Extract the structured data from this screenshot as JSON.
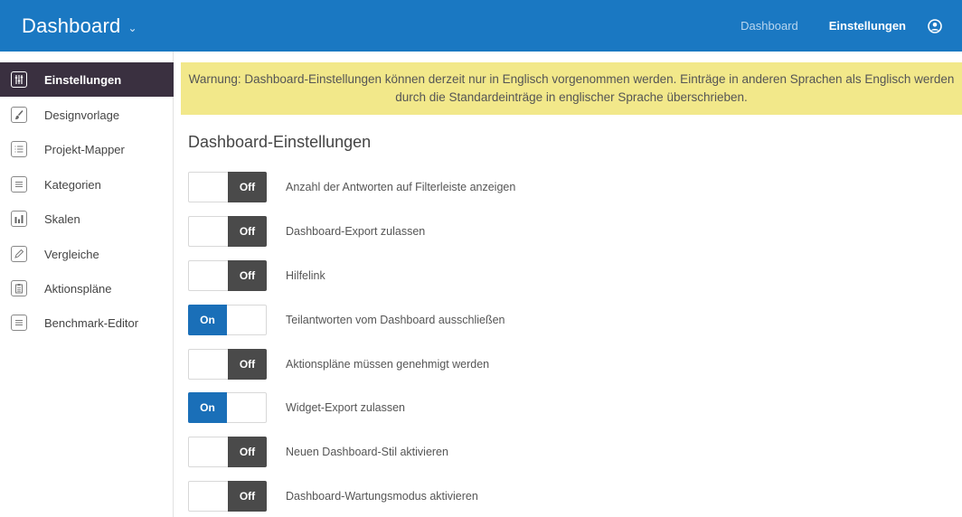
{
  "header": {
    "title": "Dashboard",
    "nav": [
      {
        "label": "Dashboard",
        "active": false
      },
      {
        "label": "Einstellungen",
        "active": true
      }
    ],
    "user_icon": "user-icon",
    "accent_color": "#1a78c2"
  },
  "sidebar": {
    "items": [
      {
        "label": "Einstellungen",
        "icon": "sliders-icon",
        "active": true
      },
      {
        "label": "Designvorlage",
        "icon": "paintbrush-icon",
        "active": false
      },
      {
        "label": "Projekt-Mapper",
        "icon": "list-icon",
        "active": false
      },
      {
        "label": "Kategorien",
        "icon": "lines-icon",
        "active": false
      },
      {
        "label": "Skalen",
        "icon": "bar-chart-icon",
        "active": false
      },
      {
        "label": "Vergleiche",
        "icon": "pencil-icon",
        "active": false
      },
      {
        "label": "Aktionspläne",
        "icon": "clipboard-icon",
        "active": false
      },
      {
        "label": "Benchmark-Editor",
        "icon": "lines-icon",
        "active": false
      }
    ]
  },
  "main": {
    "warning": "Warnung: Dashboard-Einstellungen können derzeit nur in Englisch vorgenommen werden. Einträge in anderen Sprachen als Englisch werden durch die Standardeinträge in englischer Sprache überschrieben.",
    "section_title": "Dashboard-Einstellungen",
    "settings": [
      {
        "label": "Anzahl der Antworten auf Filterleiste anzeigen",
        "state": "Off"
      },
      {
        "label": "Dashboard-Export zulassen",
        "state": "Off"
      },
      {
        "label": "Hilfelink",
        "state": "Off"
      },
      {
        "label": "Teilantworten vom Dashboard ausschließen",
        "state": "On"
      },
      {
        "label": "Aktionspläne müssen genehmigt werden",
        "state": "Off"
      },
      {
        "label": "Widget-Export zulassen",
        "state": "On"
      },
      {
        "label": "Neuen Dashboard-Stil aktivieren",
        "state": "Off"
      },
      {
        "label": "Dashboard-Wartungsmodus aktivieren",
        "state": "Off"
      }
    ]
  }
}
